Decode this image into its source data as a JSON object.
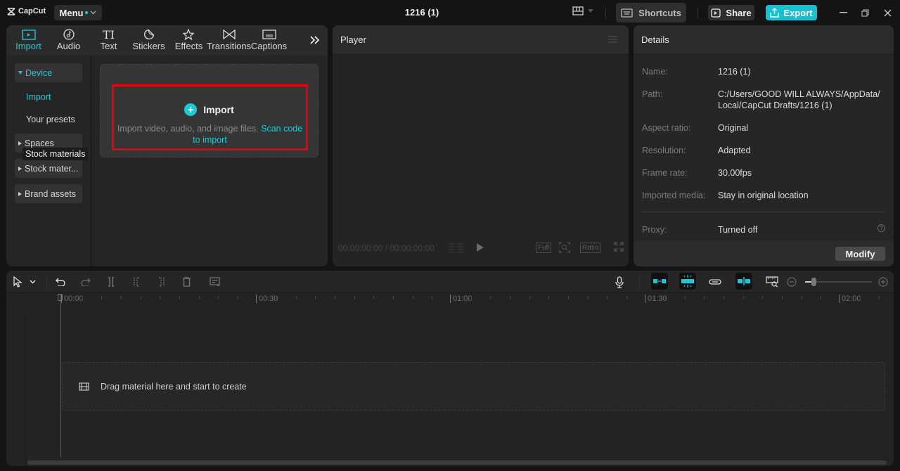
{
  "app": {
    "brand": "CapCut",
    "menu_label": "Menu",
    "project_title": "1216 (1)",
    "shortcuts_label": "Shortcuts",
    "share_label": "Share",
    "export_label": "Export",
    "accent": "#1ec8d6"
  },
  "media": {
    "tabs": [
      {
        "label": "Import",
        "icon": "import-icon",
        "active": true
      },
      {
        "label": "Audio",
        "icon": "audio-icon"
      },
      {
        "label": "Text",
        "icon": "text-icon"
      },
      {
        "label": "Stickers",
        "icon": "stickers-icon"
      },
      {
        "label": "Effects",
        "icon": "effects-icon"
      },
      {
        "label": "Transitions",
        "icon": "transitions-icon"
      },
      {
        "label": "Captions",
        "icon": "captions-icon"
      }
    ],
    "sidebar": {
      "device": "Device",
      "import": "Import",
      "presets": "Your presets",
      "spaces": "Spaces",
      "stock": "Stock mater...",
      "brand": "Brand assets",
      "tooltip": "Stock materials"
    },
    "import_card": {
      "title": "Import",
      "desc": "Import video, audio, and image files.",
      "link": "Scan code to import"
    }
  },
  "player": {
    "title": "Player",
    "time": "00:00:00:00 / 00:00:00:00",
    "full_label": "Full",
    "ratio_label": "Ratio"
  },
  "details": {
    "title": "Details",
    "rows": [
      {
        "label": "Name:",
        "value": "1216 (1)"
      },
      {
        "label": "Path:",
        "value": "C:/Users/GOOD WILL ALWAYS/AppData/ Local/CapCut Drafts/1216 (1)"
      },
      {
        "label": "Aspect ratio:",
        "value": "Original"
      },
      {
        "label": "Resolution:",
        "value": "Adapted"
      },
      {
        "label": "Frame rate:",
        "value": "30.00fps"
      },
      {
        "label": "Imported media:",
        "value": "Stay in original location"
      }
    ],
    "proxy_label": "Proxy:",
    "proxy_value": "Turned off",
    "modify_label": "Modify"
  },
  "timeline": {
    "ruler": [
      "00:00",
      "00:30",
      "01:00",
      "01:30",
      "02:00"
    ],
    "drop_text": "Drag material here and start to create",
    "zoom_level": 0.1
  }
}
